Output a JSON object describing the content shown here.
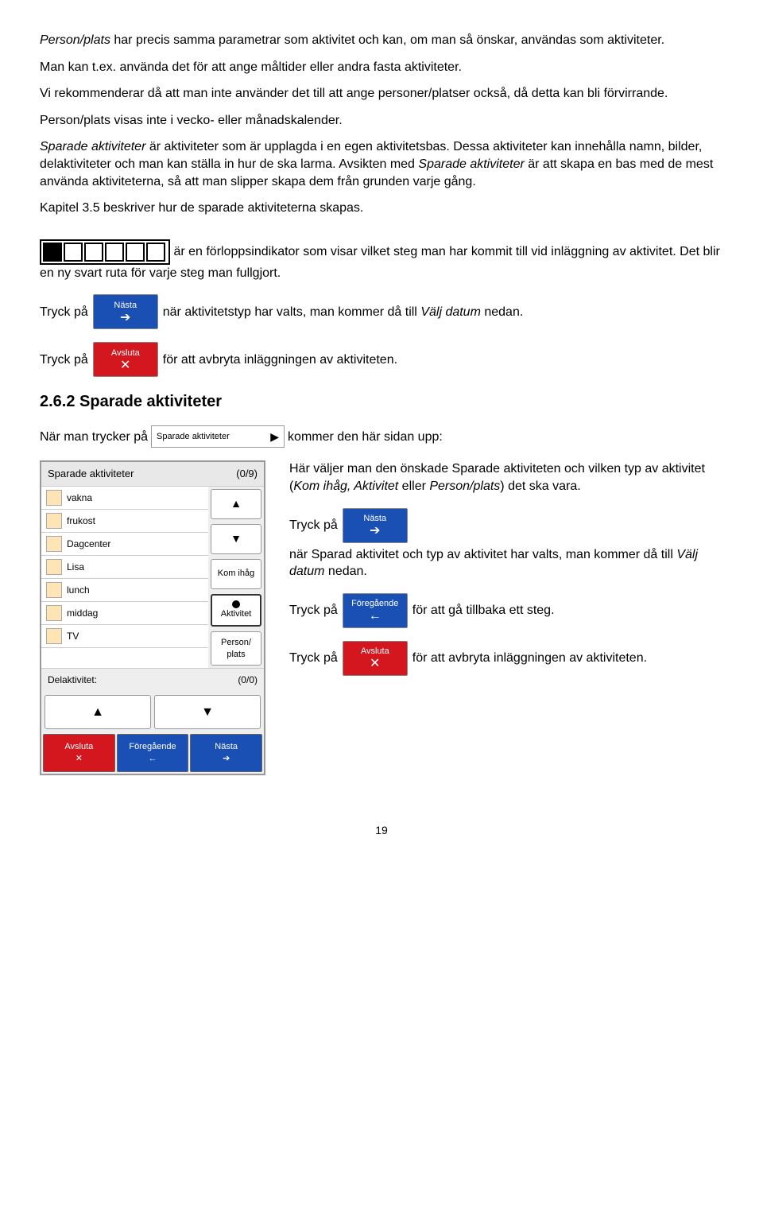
{
  "p1_pre": "Person/plats",
  "p1_post": " har precis samma parametrar som aktivitet och kan, om man så önskar, användas som aktiviteter.",
  "p2": "Man kan t.ex. använda det för att ange måltider eller andra fasta aktiviteter.",
  "p3": "Vi rekommenderar då att man inte använder det till att ange personer/platser också, då detta kan bli förvirrande.",
  "p4": "Person/plats visas inte i vecko- eller månadskalender.",
  "p5_pre": "Sparade aktiviteter",
  "p5_mid": " är aktiviteter som är upplagda i en egen aktivitetsbas. Dessa aktiviteter kan innehålla namn, bilder, delaktiviteter och man kan ställa in hur de ska larma. Avsikten med ",
  "p5_i2": "Sparade aktiviteter",
  "p5_post": " är att skapa en bas med de mest använda aktiviteterna, så att man slipper skapa dem från grunden varje gång.",
  "p6": "Kapitel 3.5 beskriver hur de sparade aktiviteterna skapas.",
  "p7": " är en förloppsindikator som visar vilket steg man har kommit till vid inläggning av aktivitet. Det blir en ny svart ruta för varje steg man fullgjort.",
  "tryck_pa": "Tryck på ",
  "nasta": "Nästa",
  "avsluta": "Avsluta",
  "foregaende": "Föregående",
  "p8_post": " när aktivitetstyp har valts, man kommer då till ",
  "valj_datum": "Välj datum",
  "nedan": " nedan.",
  "p9_post": " för att avbryta inläggningen av aktiviteten.",
  "h2": "2.6.2 Sparade aktiviteter",
  "nar_pre": "När man trycker på ",
  "sparade_akt_btn": "Sparade aktiviteter",
  "nar_post": " kommer den här sidan upp:",
  "panel": {
    "title": "Sparade aktiviteter",
    "count": "(0/9)",
    "items": [
      "vakna",
      "frukost",
      "Dagcenter",
      "Lisa",
      "lunch",
      "middag",
      "TV"
    ],
    "kom_ihag": "Kom ihåg",
    "aktivitet": "Aktivitet",
    "person_plats": "Person/\nplats",
    "delakt": "Delaktivitet:",
    "delcount": "(0/0)"
  },
  "r1_a": "Här väljer man den önskade Sparade aktiviteten och vilken typ av aktivitet (",
  "r1_i": "Kom ihåg, Aktivitet",
  "r1_b": " eller ",
  "r1_i2": "Person/plats",
  "r1_c": ") det ska vara.",
  "r2_a": " när Sparad aktivitet och typ av aktivitet har valts, man kommer då till ",
  "r3": " för att gå tillbaka ett steg.",
  "r4": " för att avbryta inläggningen av aktiviteten.",
  "page": "19"
}
